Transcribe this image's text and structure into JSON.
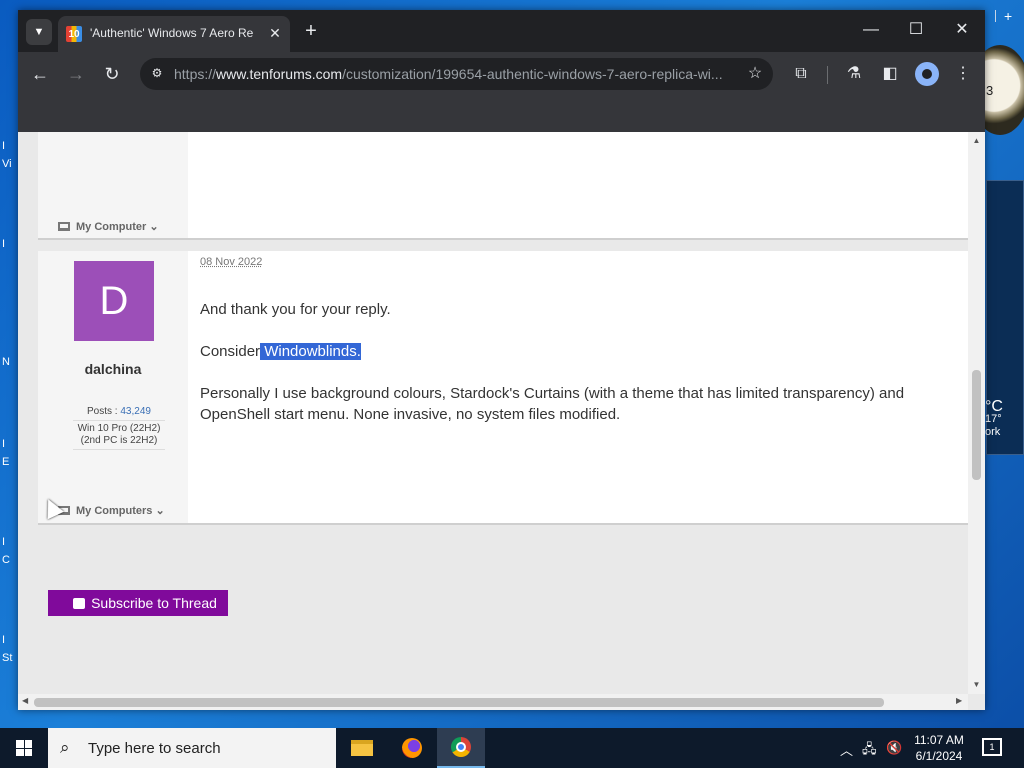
{
  "desktop": {
    "left_letters": [
      "I",
      "Vi",
      "I",
      "N",
      "I",
      "E",
      "I",
      "C",
      "I",
      "St"
    ],
    "clock_gadget_digit": "3",
    "weather": {
      "temp": "°C",
      "low": "17°",
      "place": "ork"
    }
  },
  "browser": {
    "tab_title": "'Authentic' Windows 7 Aero Re",
    "url_prefix": "https://",
    "url_domain": "www.tenforums.com",
    "url_path": "/customization/199654-authentic-windows-7-aero-replica-wi..."
  },
  "posts": [
    {
      "my_computer_label": "My Computer"
    },
    {
      "date": "08 Nov 2022",
      "avatar_letter": "D",
      "username": "dalchina",
      "posts_label": "Posts :",
      "posts_count": "43,249",
      "os_line1": "Win 10 Pro (22H2)",
      "os_line2": "(2nd PC is 22H2)",
      "my_computer_label": "My Computers",
      "line1": "And thank you for your reply.",
      "line2_prefix": "Consider",
      "line2_selected": " Windowblinds.",
      "line3": "Personally I use background colours, Stardock's Curtains (with a theme that has limited transparency) and OpenShell start menu. None invasive, no system files modified."
    }
  ],
  "subscribe_label": "Subscribe to Thread",
  "taskbar": {
    "search_placeholder": "Type here to search",
    "time": "11:07 AM",
    "date": "6/1/2024",
    "notification_count": "1"
  }
}
